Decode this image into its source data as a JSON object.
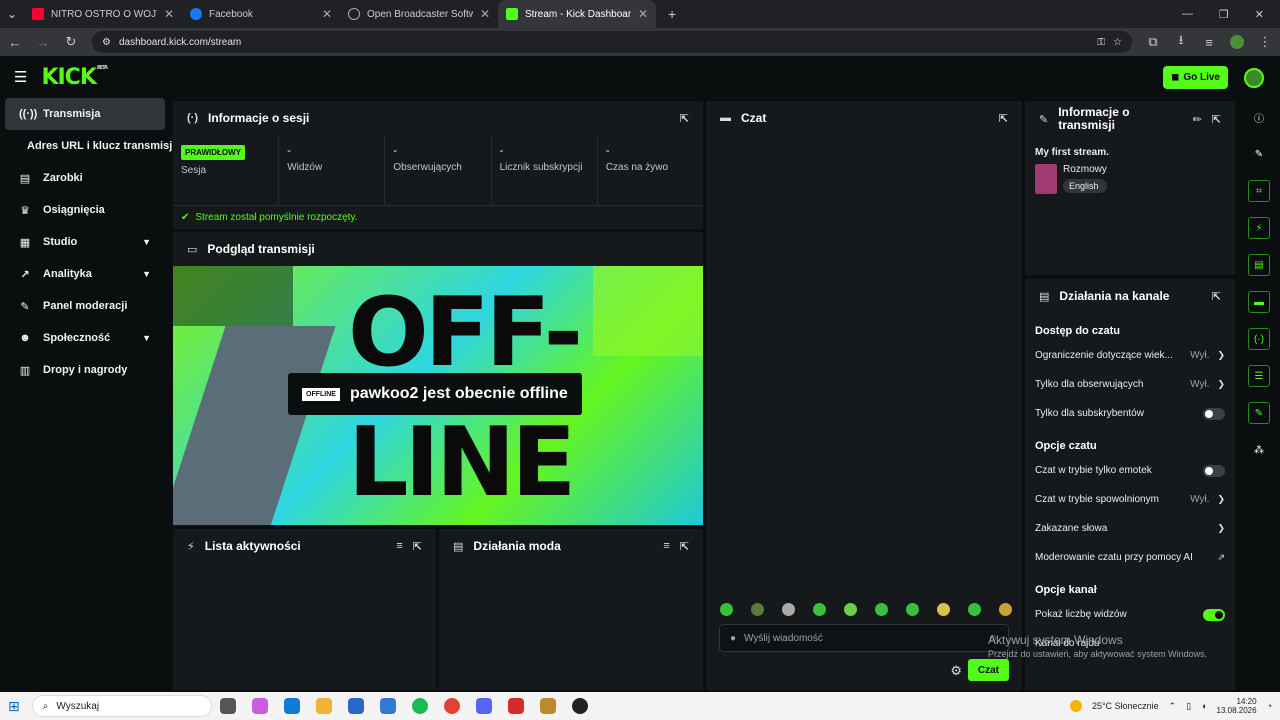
{
  "browser": {
    "tabs": [
      {
        "title": "NITRO OSTRO O WOJTKU GOL",
        "color": "#ff0033"
      },
      {
        "title": "Facebook",
        "color": "#1877f2"
      },
      {
        "title": "Open Broadcaster Software | O",
        "color": "#555"
      },
      {
        "title": "Stream - Kick Dashboard",
        "color": "#53fc18"
      }
    ],
    "url": "dashboard.kick.com/stream"
  },
  "header": {
    "logo": "KICK",
    "beta": "BETA",
    "go_live": "Go Live"
  },
  "sidebar": {
    "items": [
      {
        "label": "Transmisja",
        "icon": "broadcast-icon"
      },
      {
        "label": "Adres URL i klucz transmisji",
        "icon": ""
      },
      {
        "label": "Zarobki",
        "icon": "earnings-icon"
      },
      {
        "label": "Osiągnięcia",
        "icon": "trophy-icon"
      },
      {
        "label": "Studio",
        "icon": "studio-icon"
      },
      {
        "label": "Analityka",
        "icon": "analytics-icon"
      },
      {
        "label": "Panel moderacji",
        "icon": "wrench-icon"
      },
      {
        "label": "Społeczność",
        "icon": "community-icon"
      },
      {
        "label": "Dropy i nagrody",
        "icon": "gift-icon"
      }
    ]
  },
  "session": {
    "title": "Informacje o sesji",
    "badge": "PRAWIDŁOWY",
    "stats": [
      {
        "value": "",
        "label": "Sesja"
      },
      {
        "value": "-",
        "label": "Widzów"
      },
      {
        "value": "-",
        "label": "Obserwujących"
      },
      {
        "value": "-",
        "label": "Licznik subskrypcji"
      },
      {
        "value": "-",
        "label": "Czas na żywo"
      }
    ],
    "status": "Stream został pomyślnie rozpoczęty."
  },
  "preview": {
    "title": "Podgląd transmisji",
    "offline_badge": "OFFLINE",
    "offline_text": "pawkoo2 jest obecnie offline",
    "big1": "OFF-",
    "big2": "LINE"
  },
  "activity": {
    "title": "Lista aktywności"
  },
  "mod_actions": {
    "title": "Działania moda"
  },
  "chat": {
    "title": "Czat",
    "placeholder": "Wyślij wiadomość",
    "send": "Czat"
  },
  "stream_info": {
    "title": "Informacje o transmisji",
    "stream_title": "My first stream.",
    "category": "Rozmowy",
    "language": "English"
  },
  "channel": {
    "title": "Działania na kanale",
    "sections": [
      {
        "title": "Dostęp do czatu",
        "rows": [
          {
            "label": "Ograniczenie dotyczące wiek...",
            "value": "Wył.",
            "kind": "chev"
          },
          {
            "label": "Tylko dla obserwujących",
            "value": "Wył.",
            "kind": "chev"
          },
          {
            "label": "Tylko dla subskrybentów",
            "value": "",
            "kind": "toggle",
            "on": false
          }
        ]
      },
      {
        "title": "Opcje czatu",
        "rows": [
          {
            "label": "Czat w trybie tylko emotek",
            "value": "",
            "kind": "toggle",
            "on": false
          },
          {
            "label": "Czat w trybie spowolnionym",
            "value": "Wył.",
            "kind": "chev"
          },
          {
            "label": "Zakazane słowa",
            "value": "",
            "kind": "chev"
          },
          {
            "label": "Moderowanie czatu przy pomocy AI",
            "value": "",
            "kind": "ext"
          }
        ]
      },
      {
        "title": "Opcje kanał",
        "rows": [
          {
            "label": "Pokaż liczbę widzów",
            "value": "",
            "kind": "toggle",
            "on": true
          },
          {
            "label": "Kanał do rajdu",
            "value": "",
            "kind": "none"
          }
        ]
      }
    ]
  },
  "watermark": {
    "line1": "Aktywuj system Windows",
    "line2": "Przejdź do ustawień, aby aktywować system Windows."
  },
  "taskbar": {
    "search": "Wyszukaj",
    "weather": "25°C  Słonecznie",
    "time": "14:20",
    "date": "13.08.2026"
  }
}
